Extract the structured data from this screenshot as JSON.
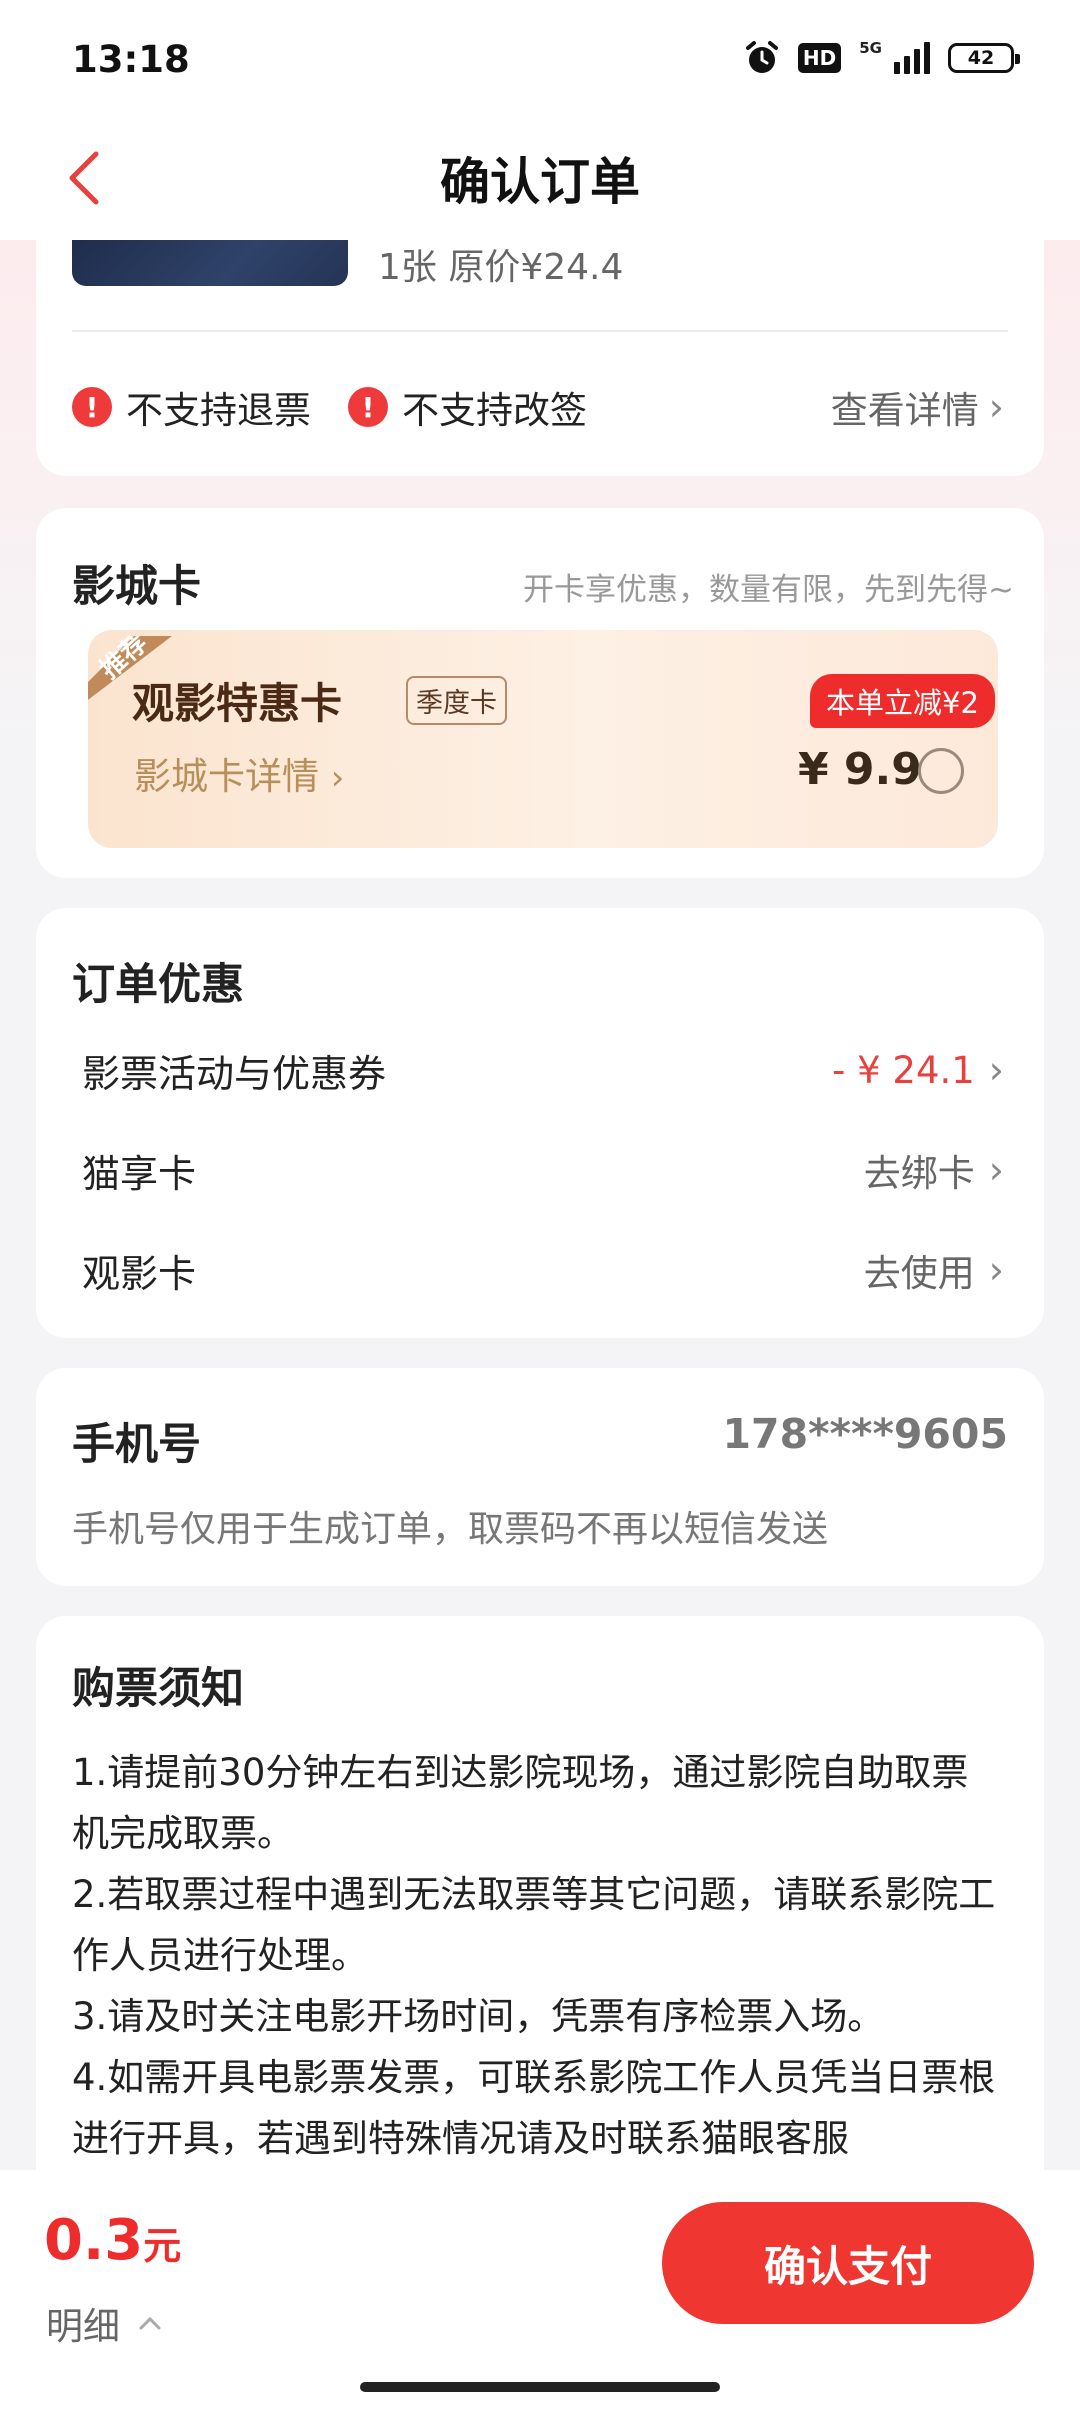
{
  "status_bar": {
    "time": "13:18",
    "hd": "HD",
    "network": "5G",
    "battery": "42",
    "icons": [
      "alarm-icon",
      "hd-icon",
      "signal-icon",
      "battery-icon"
    ]
  },
  "header": {
    "title": "确认订单",
    "back_icon": "back-chevron-icon"
  },
  "movie": {
    "ticket_info": "1张 原价¥24.4",
    "policies": [
      "不支持退票",
      "不支持改签"
    ],
    "view_details": "查看详情"
  },
  "vip_card": {
    "title": "影城卡",
    "subtitle": "开卡享优惠，数量有限，先到先得~",
    "recommend_tag": "推荐",
    "card_name": "观影特惠卡",
    "card_type": "季度卡",
    "details_link": "影城卡详情",
    "discount_badge": "本单立减¥2",
    "price": "¥ 9.9",
    "selected": false
  },
  "discounts": {
    "title": "订单优惠",
    "rows": [
      {
        "label": "影票活动与优惠券",
        "value": "- ¥ 24.1"
      },
      {
        "label": "猫享卡",
        "value": "去绑卡"
      },
      {
        "label": "观影卡",
        "value": "去使用"
      }
    ]
  },
  "phone": {
    "title": "手机号",
    "number": "178****9605",
    "note": "手机号仅用于生成订单，取票码不再以短信发送"
  },
  "notice": {
    "title": "购票须知",
    "text": "1.请提前30分钟左右到达影院现场，通过影院自助取票机完成取票。\n2.若取票过程中遇到无法取票等其它问题，请联系影院工作人员进行处理。\n3.请及时关注电影开场时间，凭票有序检票入场。\n4.如需开具电影票发票，可联系影院工作人员凭当日票根进行开具，若遇到特殊情况请及时联系猫眼客服"
  },
  "bottom": {
    "amount": "0.3",
    "unit": "元",
    "detail_label": "明细",
    "pay_label": "确认支付"
  },
  "colors": {
    "accent": "#ef3630",
    "warning": "#ee3a3a",
    "vip_gold": "#b78f5a"
  }
}
